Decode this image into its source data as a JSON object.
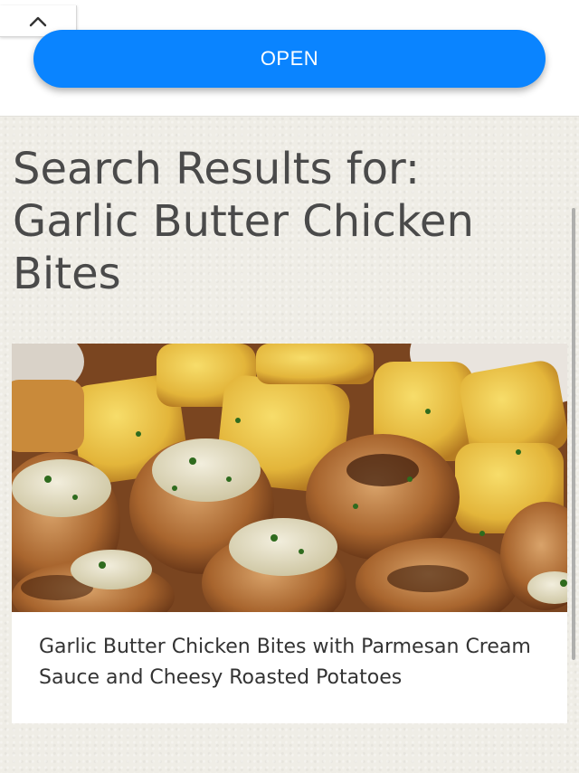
{
  "ad": {
    "open_label": "OPEN",
    "collapse_icon": "chevron-up-icon",
    "button_color": "#0a84ff"
  },
  "page": {
    "title": "Search Results for: Garlic Butter Chicken Bites"
  },
  "results": [
    {
      "image_icon": "food-photo",
      "caption": "Garlic Butter Chicken Bites with Parmesan Cream Sauce and Cheesy Roasted Potatoes"
    }
  ]
}
